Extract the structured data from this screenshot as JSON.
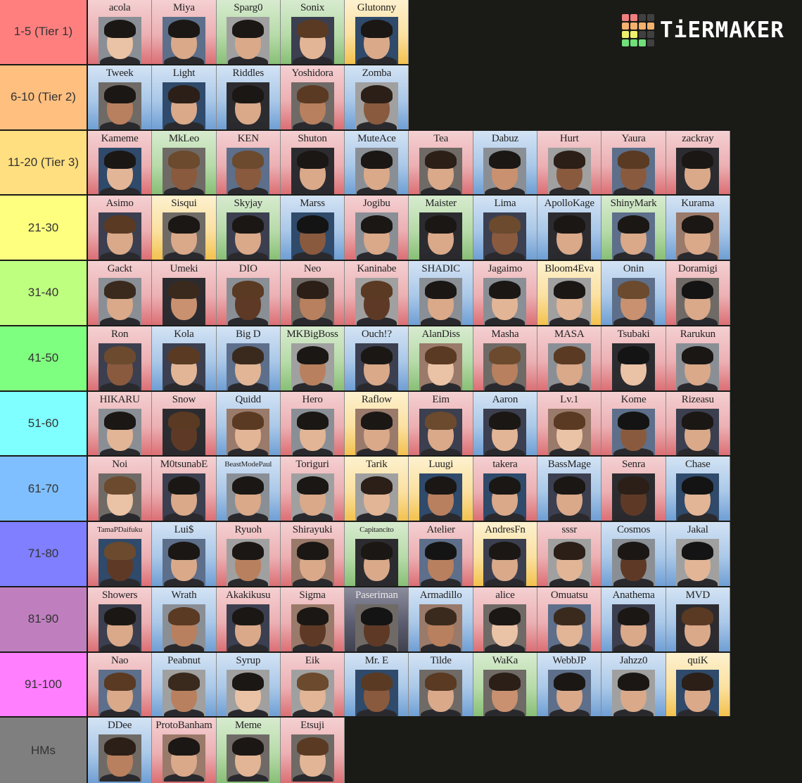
{
  "logo": {
    "text": "TiERMAKER",
    "grid_colors": [
      "#f07f80",
      "#f07f80",
      "#404040",
      "#404040",
      "#f5b16e",
      "#f5b16e",
      "#f5b16e",
      "#f5b16e",
      "#eef06c",
      "#eef06c",
      "#404040",
      "#404040",
      "#6fe07a",
      "#6fe07a",
      "#6fe07a",
      "#404040"
    ]
  },
  "card_colors": {
    "pink": "#ecb0b3",
    "blue": "#aac8e8",
    "green": "#b7dba9",
    "yellow": "#fbe0a0",
    "dark": "#5c5d70"
  },
  "tiers": [
    {
      "label": "1-5 (Tier 1)",
      "color": "#ff7f7f",
      "items": [
        {
          "name": "acola",
          "bg": "pink"
        },
        {
          "name": "Miya",
          "bg": "pink"
        },
        {
          "name": "Sparg0",
          "bg": "green"
        },
        {
          "name": "Sonix",
          "bg": "green"
        },
        {
          "name": "Glutonny",
          "bg": "yellow"
        }
      ]
    },
    {
      "label": "6-10 (Tier 2)",
      "color": "#ffbf7f",
      "items": [
        {
          "name": "Tweek",
          "bg": "blue"
        },
        {
          "name": "Light",
          "bg": "blue"
        },
        {
          "name": "Riddles",
          "bg": "blue"
        },
        {
          "name": "Yoshidora",
          "bg": "pink"
        },
        {
          "name": "Zomba",
          "bg": "blue"
        }
      ]
    },
    {
      "label": "11-20 (Tier 3)",
      "color": "#ffdf7f",
      "items": [
        {
          "name": "Kameme",
          "bg": "pink"
        },
        {
          "name": "MkLeo",
          "bg": "green"
        },
        {
          "name": "KEN",
          "bg": "pink"
        },
        {
          "name": "Shuton",
          "bg": "pink"
        },
        {
          "name": "MuteAce",
          "bg": "blue"
        },
        {
          "name": "Tea",
          "bg": "pink"
        },
        {
          "name": "Dabuz",
          "bg": "blue"
        },
        {
          "name": "Hurt",
          "bg": "pink"
        },
        {
          "name": "Yaura",
          "bg": "pink"
        },
        {
          "name": "zackray",
          "bg": "pink"
        }
      ]
    },
    {
      "label": "21-30",
      "color": "#ffff7f",
      "items": [
        {
          "name": "Asimo",
          "bg": "pink"
        },
        {
          "name": "Sisqui",
          "bg": "yellow"
        },
        {
          "name": "Skyjay",
          "bg": "green"
        },
        {
          "name": "Marss",
          "bg": "blue"
        },
        {
          "name": "Jogibu",
          "bg": "pink"
        },
        {
          "name": "Maister",
          "bg": "green"
        },
        {
          "name": "Lima",
          "bg": "blue"
        },
        {
          "name": "ApolloKage",
          "bg": "blue"
        },
        {
          "name": "ShinyMark",
          "bg": "green"
        },
        {
          "name": "Kurama",
          "bg": "blue"
        }
      ]
    },
    {
      "label": "31-40",
      "color": "#bfff7f",
      "items": [
        {
          "name": "Gackt",
          "bg": "pink"
        },
        {
          "name": "Umeki",
          "bg": "pink"
        },
        {
          "name": "DIO",
          "bg": "pink"
        },
        {
          "name": "Neo",
          "bg": "pink"
        },
        {
          "name": "Kaninabe",
          "bg": "pink"
        },
        {
          "name": "SHADIC",
          "bg": "blue"
        },
        {
          "name": "Jagaimo",
          "bg": "pink"
        },
        {
          "name": "Bloom4Eva",
          "bg": "yellow"
        },
        {
          "name": "Onin",
          "bg": "blue"
        },
        {
          "name": "Doramigi",
          "bg": "pink"
        }
      ]
    },
    {
      "label": "41-50",
      "color": "#7fff7f",
      "items": [
        {
          "name": "Ron",
          "bg": "pink"
        },
        {
          "name": "Kola",
          "bg": "blue"
        },
        {
          "name": "Big D",
          "bg": "blue"
        },
        {
          "name": "MKBigBoss",
          "bg": "green"
        },
        {
          "name": "Ouch!?",
          "bg": "blue"
        },
        {
          "name": "AlanDiss",
          "bg": "green"
        },
        {
          "name": "Masha",
          "bg": "pink"
        },
        {
          "name": "MASA",
          "bg": "pink"
        },
        {
          "name": "Tsubaki",
          "bg": "pink"
        },
        {
          "name": "Rarukun",
          "bg": "pink"
        }
      ]
    },
    {
      "label": "51-60",
      "color": "#7fffff",
      "items": [
        {
          "name": "HIKARU",
          "bg": "pink"
        },
        {
          "name": "Snow",
          "bg": "pink"
        },
        {
          "name": "Quidd",
          "bg": "blue"
        },
        {
          "name": "Hero",
          "bg": "pink"
        },
        {
          "name": "Raflow",
          "bg": "yellow"
        },
        {
          "name": "Eim",
          "bg": "pink"
        },
        {
          "name": "Aaron",
          "bg": "blue"
        },
        {
          "name": "Lv.1",
          "bg": "pink"
        },
        {
          "name": "Kome",
          "bg": "pink"
        },
        {
          "name": "Rizeasu",
          "bg": "pink"
        }
      ]
    },
    {
      "label": "61-70",
      "color": "#7fbfff",
      "items": [
        {
          "name": "Noi",
          "bg": "pink"
        },
        {
          "name": "M0tsunabE",
          "bg": "pink"
        },
        {
          "name": "BeastModePaul",
          "bg": "blue",
          "small": true
        },
        {
          "name": "Toriguri",
          "bg": "pink"
        },
        {
          "name": "Tarik",
          "bg": "yellow"
        },
        {
          "name": "Luugi",
          "bg": "yellow"
        },
        {
          "name": "takera",
          "bg": "pink"
        },
        {
          "name": "BassMage",
          "bg": "blue"
        },
        {
          "name": "Senra",
          "bg": "pink"
        },
        {
          "name": "Chase",
          "bg": "blue"
        }
      ]
    },
    {
      "label": "71-80",
      "color": "#7f7fff",
      "items": [
        {
          "name": "TamaPDaifuku",
          "bg": "pink",
          "small": true
        },
        {
          "name": "Lui$",
          "bg": "blue"
        },
        {
          "name": "Ryuoh",
          "bg": "pink"
        },
        {
          "name": "Shirayuki",
          "bg": "pink"
        },
        {
          "name": "Capitancito",
          "bg": "green",
          "small": true
        },
        {
          "name": "Atelier",
          "bg": "pink"
        },
        {
          "name": "AndresFn",
          "bg": "yellow"
        },
        {
          "name": "sssr",
          "bg": "pink"
        },
        {
          "name": "Cosmos",
          "bg": "blue"
        },
        {
          "name": "Jakal",
          "bg": "blue"
        }
      ]
    },
    {
      "label": "81-90",
      "color": "#bf7fbf",
      "items": [
        {
          "name": "Showers",
          "bg": "pink"
        },
        {
          "name": "Wrath",
          "bg": "blue"
        },
        {
          "name": "Akakikusu",
          "bg": "pink"
        },
        {
          "name": "Sigma",
          "bg": "pink"
        },
        {
          "name": "Paseriman",
          "bg": "dark"
        },
        {
          "name": "Armadillo",
          "bg": "blue"
        },
        {
          "name": "alice",
          "bg": "pink"
        },
        {
          "name": "Omuatsu",
          "bg": "pink"
        },
        {
          "name": "Anathema",
          "bg": "blue"
        },
        {
          "name": "MVD",
          "bg": "blue"
        }
      ]
    },
    {
      "label": "91-100",
      "color": "#ff7fff",
      "items": [
        {
          "name": "Nao",
          "bg": "pink"
        },
        {
          "name": "Peabnut",
          "bg": "blue"
        },
        {
          "name": "Syrup",
          "bg": "blue"
        },
        {
          "name": "Eik",
          "bg": "pink"
        },
        {
          "name": "Mr. E",
          "bg": "blue"
        },
        {
          "name": "Tilde",
          "bg": "blue"
        },
        {
          "name": "WaKa",
          "bg": "green"
        },
        {
          "name": "WebbJP",
          "bg": "blue"
        },
        {
          "name": "Jahzz0",
          "bg": "blue"
        },
        {
          "name": "quiK",
          "bg": "yellow"
        }
      ]
    },
    {
      "label": "HMs",
      "color": "#7f7f7f",
      "items": [
        {
          "name": "DDee",
          "bg": "blue"
        },
        {
          "name": "ProtoBanham",
          "bg": "pink"
        },
        {
          "name": "Meme",
          "bg": "green"
        },
        {
          "name": "Etsuji",
          "bg": "pink"
        }
      ]
    }
  ]
}
